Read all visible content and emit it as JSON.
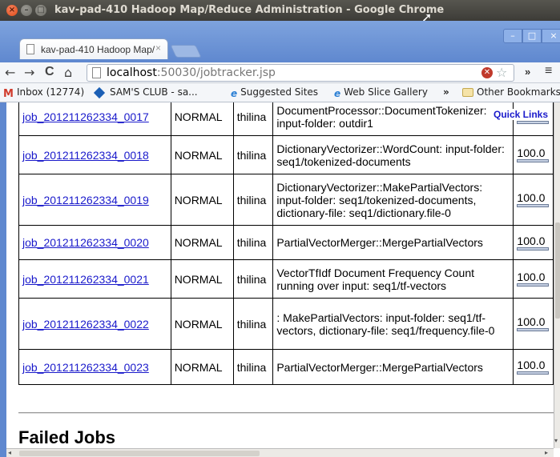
{
  "window": {
    "title": "kav-pad-410 Hadoop Map/Reduce Administration - Google Chrome",
    "close_glyph": "×",
    "min_glyph": "–",
    "max_glyph": "□"
  },
  "browser": {
    "tab_label": "kav-pad-410 Hadoop Map/",
    "tab_close": "×",
    "window_controls": {
      "min": "–",
      "max": "□",
      "close": "×"
    },
    "nav": {
      "back": "←",
      "forward": "→",
      "reload": "C",
      "home": "⌂"
    },
    "url_host": "localhost",
    "url_rest": ":50030/jobtracker.jsp",
    "more": "»",
    "menu": "≡"
  },
  "bookmarks": {
    "items": [
      {
        "label": "Inbox (12774)",
        "icon": "gmail-icon",
        "glyph": "M"
      },
      {
        "label": "SAM'S CLUB - sa...",
        "icon": "diamond-icon"
      },
      {
        "label": "Suggested Sites",
        "icon": "ie-icon",
        "glyph": "e"
      },
      {
        "label": "Web Slice Gallery",
        "icon": "ie-icon",
        "glyph": "e"
      }
    ],
    "overflow": "»",
    "other": "Other Bookmarks"
  },
  "page": {
    "quick_links": "Quick Links",
    "jobs": [
      {
        "id": "job_201211262334_0017",
        "priority": "NORMAL",
        "user": "thilina",
        "name": "DocumentProcessor::DocumentTokenizer: input-folder: outdir1",
        "pct": "100.0",
        "progress": 1.0
      },
      {
        "id": "job_201211262334_0018",
        "priority": "NORMAL",
        "user": "thilina",
        "name": "DictionaryVectorizer::WordCount: input-folder: seq1/tokenized-documents",
        "pct": "100.0",
        "progress": 1.0
      },
      {
        "id": "job_201211262334_0019",
        "priority": "NORMAL",
        "user": "thilina",
        "name": "DictionaryVectorizer::MakePartialVectors: input-folder: seq1/tokenized-documents, dictionary-file: seq1/dictionary.file-0",
        "pct": "100.0",
        "progress": 1.0
      },
      {
        "id": "job_201211262334_0020",
        "priority": "NORMAL",
        "user": "thilina",
        "name": "PartialVectorMerger::MergePartialVectors",
        "pct": "100.0",
        "progress": 1.0
      },
      {
        "id": "job_201211262334_0021",
        "priority": "NORMAL",
        "user": "thilina",
        "name": "VectorTfIdf Document Frequency Count running over input: seq1/tf-vectors",
        "pct": "100.0",
        "progress": 1.0
      },
      {
        "id": "job_201211262334_0022",
        "priority": "NORMAL",
        "user": "thilina",
        "name": ": MakePartialVectors: input-folder: seq1/tf-vectors, dictionary-file: seq1/frequency.file-0",
        "pct": "100.0",
        "progress": 1.0
      },
      {
        "id": "job_201211262334_0023",
        "priority": "NORMAL",
        "user": "thilina",
        "name": "PartialVectorMerger::MergePartialVectors",
        "pct": "100.0",
        "progress": 1.0
      }
    ],
    "failed_heading": "Failed Jobs"
  }
}
